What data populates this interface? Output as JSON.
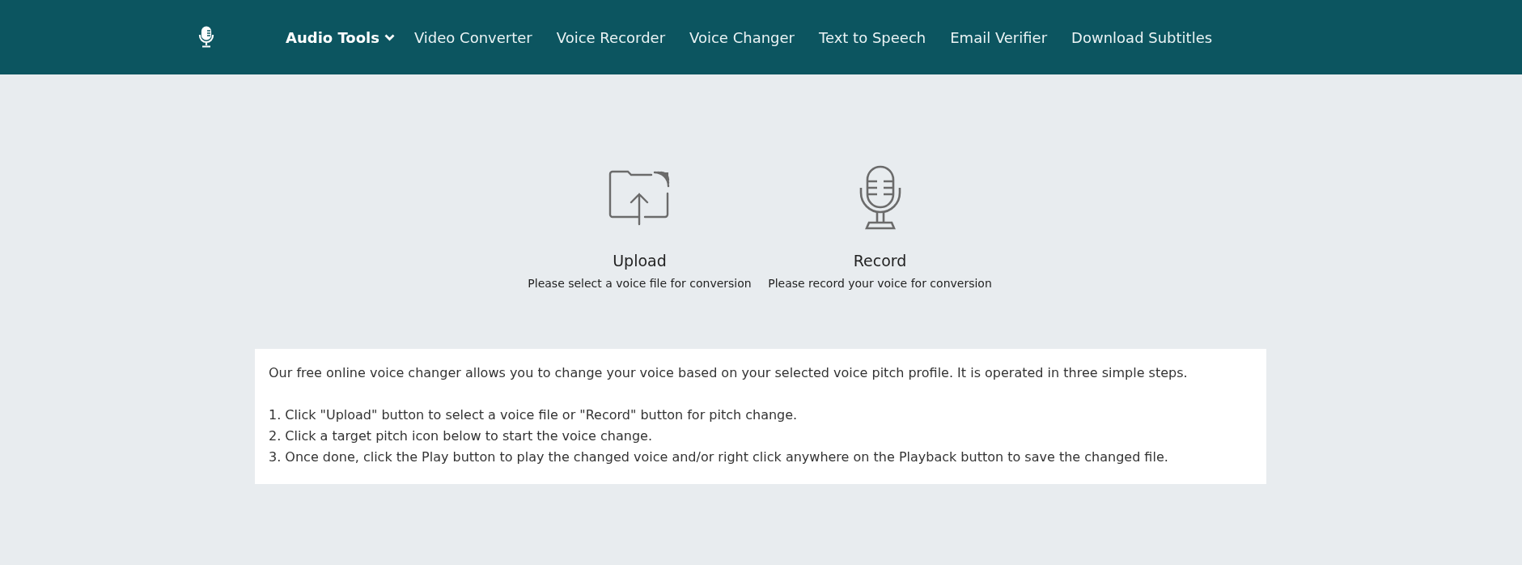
{
  "nav": {
    "items": [
      {
        "label": "Audio Tools",
        "kind": "dropdown"
      },
      {
        "label": "Video Converter",
        "kind": "link"
      },
      {
        "label": "Voice Recorder",
        "kind": "link"
      },
      {
        "label": "Voice Changer",
        "kind": "link"
      },
      {
        "label": "Text to Speech",
        "kind": "link"
      },
      {
        "label": "Email Verifier",
        "kind": "link"
      },
      {
        "label": "Download Subtitles",
        "kind": "link"
      }
    ]
  },
  "actions": [
    {
      "kind": "upload",
      "title": "Upload",
      "subtitle": "Please select a voice file for conversion"
    },
    {
      "kind": "record",
      "title": "Record",
      "subtitle": "Please record your voice for conversion"
    }
  ],
  "info": {
    "intro": "Our free online voice changer allows you to change your voice based on your selected voice pitch profile. It is operated in three simple steps.",
    "steps": [
      "1. Click \"Upload\" button to select a voice file or \"Record\" button for pitch change.",
      "2. Click a target pitch icon below to start the voice change.",
      "3. Once done, click the Play button to play the changed voice and/or right click anywhere on the Playback button to save the changed file."
    ]
  }
}
